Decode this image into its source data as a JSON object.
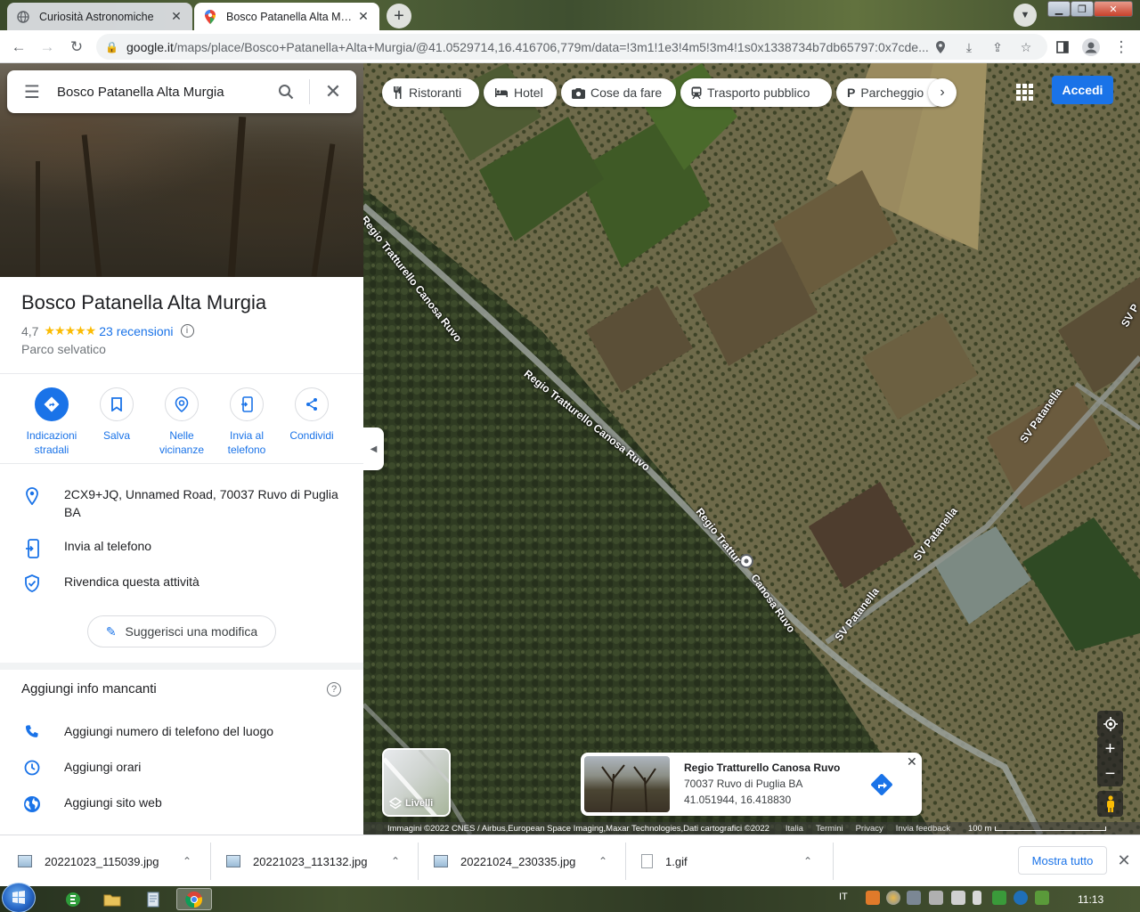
{
  "browser": {
    "tabs": [
      {
        "title": "Curiosità Astronomiche",
        "active": false
      },
      {
        "title": "Bosco Patanella Alta Murgia",
        "active": true
      }
    ],
    "url_domain": "google.it",
    "url_path": "/maps/place/Bosco+Patanella+Alta+Murgia/@41.0529714,16.416706,779m/data=!3m1!1e3!4m5!3m4!1s0x1338734b7db65797:0x7cde..."
  },
  "search": {
    "value": "Bosco Patanella Alta Murgia"
  },
  "place": {
    "title": "Bosco Patanella Alta Murgia",
    "rating": "4,7",
    "stars": "★★★★★",
    "reviews": "23 recensioni",
    "rating_value": 4.7,
    "category": "Parco selvatico"
  },
  "actions": [
    {
      "label": "Indicazioni stradali",
      "icon": "directions-icon"
    },
    {
      "label": "Salva",
      "icon": "bookmark-icon"
    },
    {
      "label": "Nelle vicinanze",
      "icon": "nearby-icon"
    },
    {
      "label": "Invia al telefono",
      "icon": "send-to-phone-icon"
    },
    {
      "label": "Condividi",
      "icon": "share-icon"
    }
  ],
  "info": {
    "address": "2CX9+JQ, Unnamed Road, 70037 Ruvo di Puglia BA",
    "send_to_phone": "Invia al telefono",
    "claim": "Rivendica questa attività",
    "suggest_edit": "Suggerisci una modifica"
  },
  "missing": {
    "title": "Aggiungi info mancanti",
    "items": [
      {
        "label": "Aggiungi numero di telefono del luogo",
        "icon": "phone-icon"
      },
      {
        "label": "Aggiungi orari",
        "icon": "clock-icon"
      },
      {
        "label": "Aggiungi sito web",
        "icon": "globe-icon"
      }
    ]
  },
  "map": {
    "chips": [
      "Ristoranti",
      "Hotel",
      "Cose da fare",
      "Trasporto pubblico",
      "Parcheggio"
    ],
    "signin": "Accedi",
    "layers": "Livelli",
    "road_labels": [
      {
        "text": "Regio Tratturello Canosa Ruvo"
      },
      {
        "text": "Regio Tratturello Canosa Ruvo"
      },
      {
        "text": "Regio Trattur"
      },
      {
        "text": "Canosa Ruvo"
      },
      {
        "text": "SV Patanella"
      },
      {
        "text": "SV Patanella"
      },
      {
        "text": "SV Patanella"
      },
      {
        "text": "SV P"
      }
    ],
    "card": {
      "title": "Regio Tratturello Canosa Ruvo",
      "address": "70037 Ruvo di Puglia BA",
      "coords": "41.051944, 16.418830"
    },
    "attribution": "Immagini ©2022 CNES / Airbus,European Space Imaging,Maxar Technologies,Dati cartografici ©2022",
    "links": [
      "Italia",
      "Termini",
      "Privacy",
      "Invia feedback"
    ],
    "scale": "100 m"
  },
  "downloads": {
    "files": [
      "20221023_115039.jpg",
      "20221023_113132.jpg",
      "20221024_230335.jpg",
      "1.gif"
    ],
    "show_all": "Mostra tutto"
  },
  "taskbar": {
    "lang": "IT",
    "time": "11:13"
  },
  "colors": {
    "accent": "#1a73e8",
    "star": "#fbbc04"
  }
}
